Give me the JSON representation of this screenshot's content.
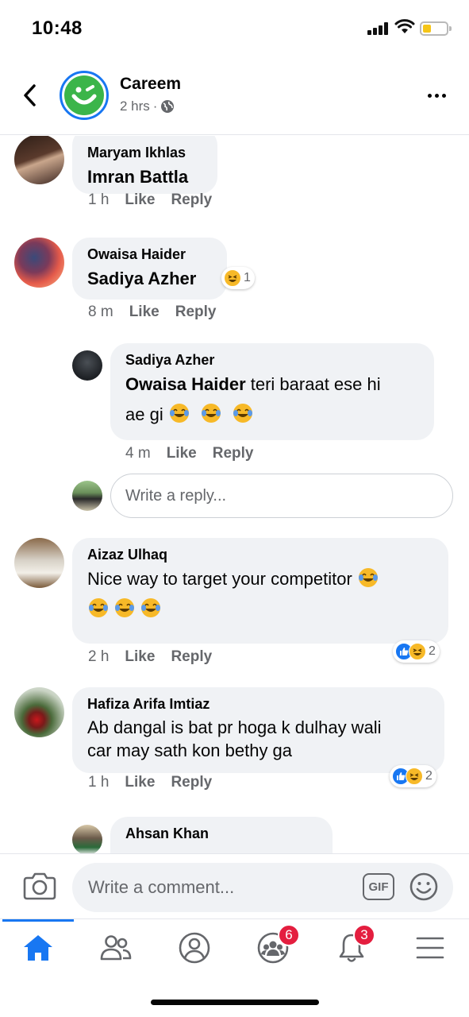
{
  "status_bar": {
    "time": "10:48"
  },
  "header": {
    "page_name": "Careem",
    "post_time": "2 hrs",
    "post_time_separator": "·"
  },
  "comments": [
    {
      "author": "Maryam Ikhlas",
      "text": "Imran Battla",
      "time": "1 h",
      "like": "Like",
      "reply": "Reply"
    },
    {
      "author": "Owaisa Haider",
      "text": "Sadiya Azher",
      "time": "8 m",
      "like": "Like",
      "reply": "Reply",
      "reaction_count": "1"
    },
    {
      "author": "Sadiya Azher",
      "mention": "Owaisa Haider",
      "text_line1": " teri baraat ese hi",
      "text_line2": "ae gi",
      "time": "4 m",
      "like": "Like",
      "reply": "Reply"
    },
    {
      "author": "Aizaz Ulhaq",
      "text_line1": "Nice way to target your competitor",
      "time": "2 h",
      "like": "Like",
      "reply": "Reply",
      "reaction_count": "2"
    },
    {
      "author": "Hafiza Arifa Imtiaz",
      "text_line1": "Ab dangal is bat pr hoga k dulhay wali",
      "text_line2": "car may sath kon bethy ga",
      "time": "1 h",
      "like": "Like",
      "reply": "Reply",
      "reaction_count": "2"
    },
    {
      "author": "Ahsan Khan"
    }
  ],
  "reply_box": {
    "placeholder": "Write a reply..."
  },
  "composer": {
    "placeholder": "Write a comment...",
    "gif_label": "GIF"
  },
  "tabbar": {
    "groups_badge": "6",
    "notifications_badge": "3"
  },
  "colors": {
    "accent": "#1877f2",
    "badge": "#e41e3f",
    "bubble": "#f0f2f5",
    "careem_green": "#3bb54a"
  }
}
